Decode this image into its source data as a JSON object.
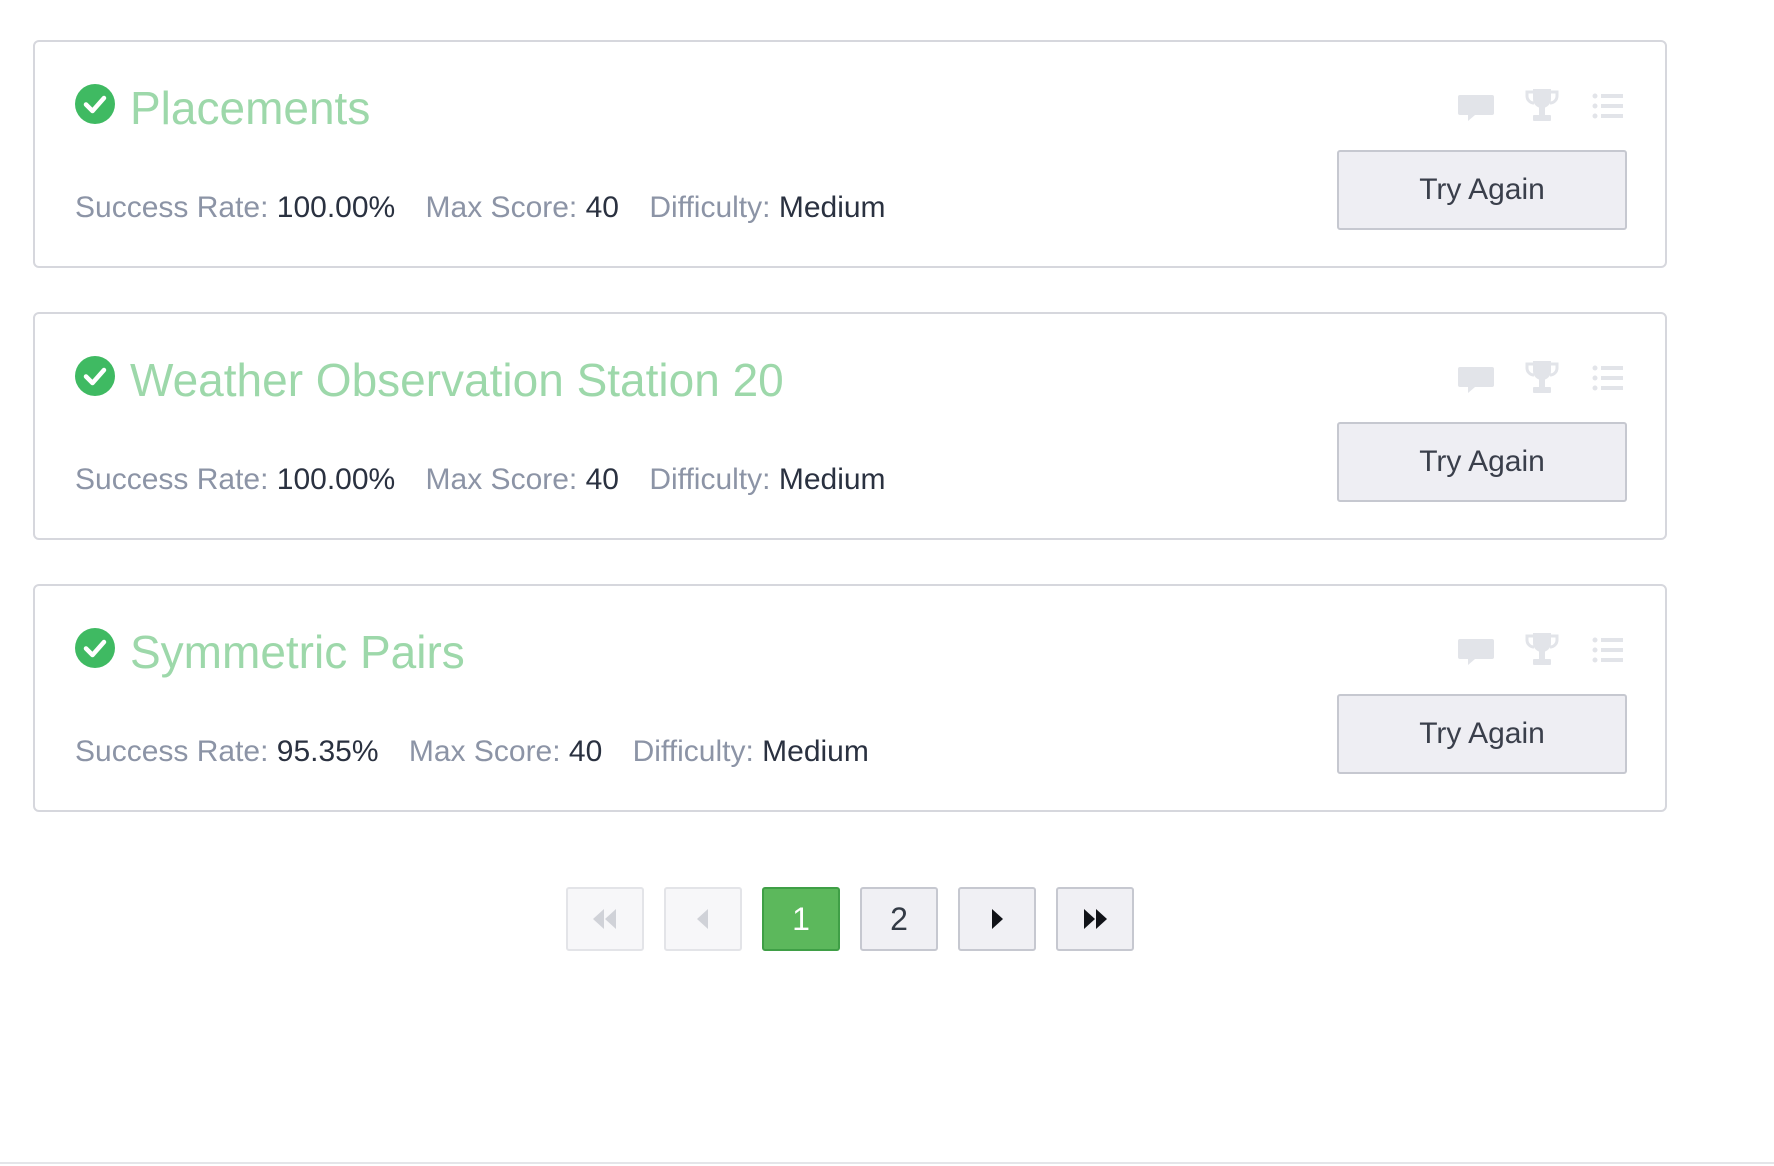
{
  "challenges": [
    {
      "title": "Placements",
      "status": "solved",
      "success_rate_label": "Success Rate:",
      "success_rate": "100.00%",
      "max_score_label": "Max Score:",
      "max_score": "40",
      "difficulty_label": "Difficulty:",
      "difficulty": "Medium",
      "button_label": "Try Again"
    },
    {
      "title": "Weather Observation Station 20",
      "status": "solved",
      "success_rate_label": "Success Rate:",
      "success_rate": "100.00%",
      "max_score_label": "Max Score:",
      "max_score": "40",
      "difficulty_label": "Difficulty:",
      "difficulty": "Medium",
      "button_label": "Try Again"
    },
    {
      "title": "Symmetric Pairs",
      "status": "solved",
      "success_rate_label": "Success Rate:",
      "success_rate": "95.35%",
      "max_score_label": "Max Score:",
      "max_score": "40",
      "difficulty_label": "Difficulty:",
      "difficulty": "Medium",
      "button_label": "Try Again"
    }
  ],
  "card_icons": [
    "discussion-icon",
    "leaderboard-trophy-icon",
    "editorial-list-icon"
  ],
  "pagination": {
    "first_icon": "double-chevron-left-icon",
    "prev_icon": "caret-left-icon",
    "pages": [
      "1",
      "2"
    ],
    "current_page": "1",
    "next_icon": "caret-right-icon",
    "last_icon": "double-chevron-right-icon"
  },
  "colors": {
    "solved_green": "#3fba62",
    "title_green": "#9dd8aa",
    "active_page": "#5cb85c",
    "label_gray": "#8c94a6",
    "value_dark": "#2a3140"
  }
}
